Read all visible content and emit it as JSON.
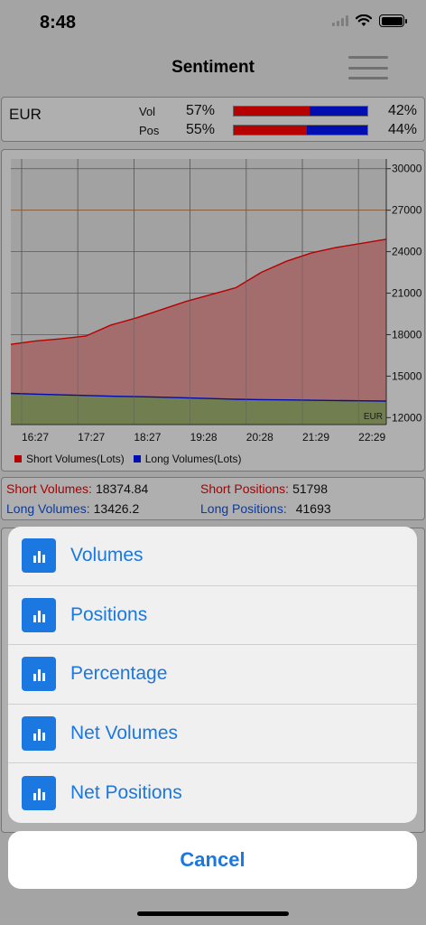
{
  "status": {
    "time": "8:48"
  },
  "nav": {
    "title": "Sentiment",
    "menu_icon": "hamburger-icon"
  },
  "summary": {
    "currency": "EUR",
    "vol": {
      "label": "Vol",
      "short_pct": "57%",
      "long_pct": "42%",
      "short_fraction": 0.57
    },
    "pos": {
      "label": "Pos",
      "short_pct": "55%",
      "long_pct": "44%",
      "short_fraction": 0.55
    },
    "colors": {
      "short": "#e00000",
      "long": "#0010d8"
    }
  },
  "chart_data": {
    "type": "area",
    "x": [
      "16:27",
      "17:27",
      "18:27",
      "19:28",
      "20:28",
      "21:29",
      "22:29"
    ],
    "ylim": [
      11500,
      30700
    ],
    "y_ticks": [
      "30000",
      "27000",
      "24000",
      "21000",
      "18000",
      "15000",
      "12000"
    ],
    "ref_line": 27000,
    "watermark": "EUR",
    "grid": true,
    "series": [
      {
        "name": "Short Volumes(Lots)",
        "color": "#e00000",
        "fill": "#c98585",
        "values": [
          17300,
          17550,
          17700,
          17900,
          18700,
          19200,
          19800,
          20400,
          20900,
          21400,
          22500,
          23300,
          23900,
          24300,
          24600,
          24900
        ]
      },
      {
        "name": "Long Volumes(Lots)",
        "color": "#0010d8",
        "fill": "#8a9a61",
        "values": [
          13750,
          13700,
          13650,
          13600,
          13550,
          13520,
          13480,
          13430,
          13380,
          13330,
          13300,
          13280,
          13260,
          13240,
          13220,
          13200
        ]
      }
    ]
  },
  "stats": {
    "short_volumes_label": "Short Volumes:",
    "short_volumes_value": "18374.84",
    "long_volumes_label": "Long Volumes:",
    "long_volumes_value": "13426.2",
    "short_positions_label": "Short Positions:",
    "short_positions_value": "51798",
    "long_positions_label": "Long Positions:",
    "long_positions_value": "41693"
  },
  "sheet": {
    "items": [
      {
        "label": "Volumes",
        "icon": "bar-chart-icon"
      },
      {
        "label": "Positions",
        "icon": "bar-chart-icon"
      },
      {
        "label": "Percentage",
        "icon": "bar-chart-icon"
      },
      {
        "label": "Net Volumes",
        "icon": "bar-chart-icon"
      },
      {
        "label": "Net Positions",
        "icon": "bar-chart-icon"
      }
    ],
    "cancel": "Cancel",
    "accent": "#1a78e0"
  }
}
